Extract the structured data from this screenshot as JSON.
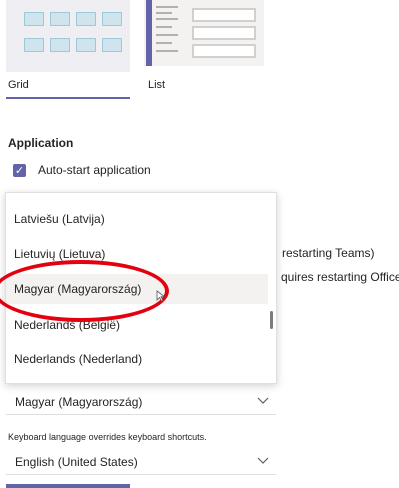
{
  "layout": {
    "options": [
      {
        "label": "Grid",
        "selected": true
      },
      {
        "label": "List",
        "selected": false
      }
    ]
  },
  "application": {
    "title": "Application",
    "auto_start_label": "Auto-start application",
    "auto_start_checked": true,
    "behind_text_1": "restarting Teams)",
    "behind_text_2": "quires restarting Office"
  },
  "language": {
    "dropdown_items": [
      "Latviešu (Latvija)",
      "Lietuvių (Lietuva)",
      "Magyar (Magyarország)",
      "Nederlands (België)",
      "Nederlands (Nederland)"
    ],
    "hovered_item": "Magyar (Magyarország)",
    "app_language_value": "Magyar (Magyarország)",
    "keyboard_note": "Keyboard language overrides keyboard shortcuts.",
    "keyboard_language_value": "English (United States)"
  },
  "colors": {
    "accent": "#6264a7",
    "annotation": "#e3000f"
  }
}
